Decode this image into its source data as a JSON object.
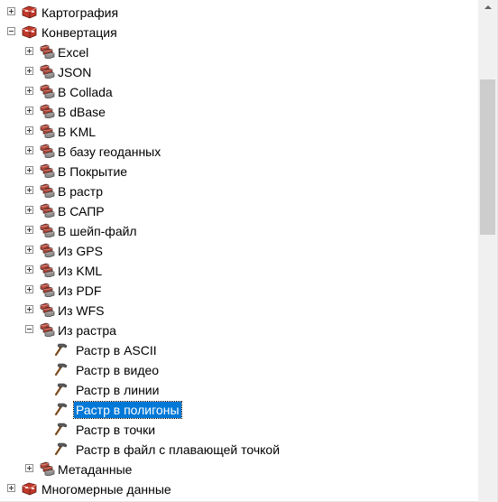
{
  "colors": {
    "selection": "#0078d7",
    "scrollbar_track": "#f0f0f0",
    "scrollbar_thumb": "#cdcdcd"
  },
  "scroll": {
    "thumb_fraction": 0.31,
    "position_fraction": 0.16
  },
  "tree": [
    {
      "id": "kartografiya",
      "label": "Картография",
      "level": 0,
      "expander": "plus",
      "icon": "toolbox-icon"
    },
    {
      "id": "konvertatsiya",
      "label": "Конвертация",
      "level": 0,
      "expander": "minus",
      "icon": "toolbox-icon"
    },
    {
      "id": "excel",
      "label": "Excel",
      "level": 1,
      "expander": "plus",
      "icon": "toolset-icon"
    },
    {
      "id": "json",
      "label": "JSON",
      "level": 1,
      "expander": "plus",
      "icon": "toolset-icon"
    },
    {
      "id": "collada",
      "label": "В Collada",
      "level": 1,
      "expander": "plus",
      "icon": "toolset-icon"
    },
    {
      "id": "dbase",
      "label": "В dBase",
      "level": 1,
      "expander": "plus",
      "icon": "toolset-icon"
    },
    {
      "id": "kml",
      "label": "В KML",
      "level": 1,
      "expander": "plus",
      "icon": "toolset-icon"
    },
    {
      "id": "geodatabase",
      "label": "В базу геоданных",
      "level": 1,
      "expander": "plus",
      "icon": "toolset-icon"
    },
    {
      "id": "coverage",
      "label": "В Покрытие",
      "level": 1,
      "expander": "plus",
      "icon": "toolset-icon"
    },
    {
      "id": "raster",
      "label": "В растр",
      "level": 1,
      "expander": "plus",
      "icon": "toolset-icon"
    },
    {
      "id": "cad",
      "label": "В САПР",
      "level": 1,
      "expander": "plus",
      "icon": "toolset-icon"
    },
    {
      "id": "shapefile",
      "label": "В шейп-файл",
      "level": 1,
      "expander": "plus",
      "icon": "toolset-icon"
    },
    {
      "id": "from-gps",
      "label": "Из GPS",
      "level": 1,
      "expander": "plus",
      "icon": "toolset-icon"
    },
    {
      "id": "from-kml",
      "label": "Из KML",
      "level": 1,
      "expander": "plus",
      "icon": "toolset-icon"
    },
    {
      "id": "from-pdf",
      "label": "Из PDF",
      "level": 1,
      "expander": "plus",
      "icon": "toolset-icon"
    },
    {
      "id": "from-wfs",
      "label": "Из WFS",
      "level": 1,
      "expander": "plus",
      "icon": "toolset-icon"
    },
    {
      "id": "from-raster",
      "label": "Из растра",
      "level": 1,
      "expander": "minus",
      "icon": "toolset-icon"
    },
    {
      "id": "raster-ascii",
      "label": "Растр в ASCII",
      "level": 2,
      "expander": "none",
      "icon": "hammer-icon"
    },
    {
      "id": "raster-video",
      "label": "Растр в видео",
      "level": 2,
      "expander": "none",
      "icon": "hammer-icon"
    },
    {
      "id": "raster-lines",
      "label": "Растр в линии",
      "level": 2,
      "expander": "none",
      "icon": "hammer-icon"
    },
    {
      "id": "raster-polygons",
      "label": "Растр в полигоны",
      "level": 2,
      "expander": "none",
      "icon": "hammer-icon",
      "selected": true
    },
    {
      "id": "raster-points",
      "label": "Растр в точки",
      "level": 2,
      "expander": "none",
      "icon": "hammer-icon"
    },
    {
      "id": "raster-float",
      "label": "Растр в файл с плавающей точкой",
      "level": 2,
      "expander": "none",
      "icon": "hammer-icon"
    },
    {
      "id": "metadata",
      "label": "Метаданные",
      "level": 1,
      "expander": "plus",
      "icon": "toolset-icon"
    },
    {
      "id": "multidimensional",
      "label": "Многомерные данные",
      "level": 0,
      "expander": "plus",
      "icon": "toolbox-icon"
    }
  ]
}
